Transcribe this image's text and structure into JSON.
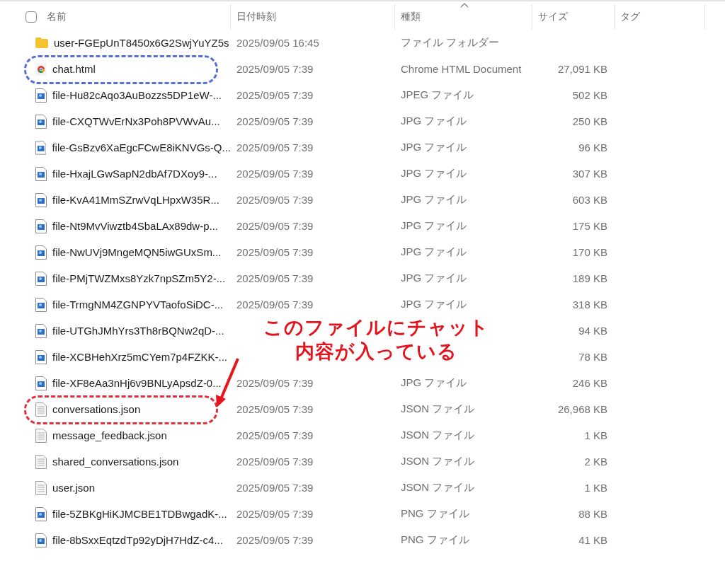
{
  "header": {
    "select_all_checked": false,
    "columns": [
      {
        "label": "名前",
        "sorted": false
      },
      {
        "label": "日付時刻",
        "sorted": false
      },
      {
        "label": "種類",
        "sorted": true
      },
      {
        "label": "サイズ",
        "sorted": false
      },
      {
        "label": "タグ",
        "sorted": false
      }
    ]
  },
  "rows": [
    {
      "kind": "folder",
      "name": "user-FGEpUnT8450x6G2SwjYuYZ5s",
      "date": "2025/09/05 16:45",
      "type": "ファイル フォルダー",
      "circled": false
    },
    {
      "kind": "html",
      "name": "chat.html",
      "date": "2025/09/05 7:39",
      "type": "Chrome HTML Document",
      "size": "27,091 KB",
      "circled": true,
      "color": "#5470d8"
    },
    {
      "kind": "image",
      "name": "file-Hu82cAqo3AuBozzs5DP1eW-...",
      "date": "2025/09/05 7:39",
      "type": "JPEG ファイル",
      "size": "502 KB",
      "circled": false
    },
    {
      "kind": "image",
      "name": "file-CXQTWvErNx3Poh8PVWvAu...",
      "date": "2025/09/05 7:39",
      "type": "JPG ファイル",
      "size": "250 KB",
      "circled": false
    },
    {
      "kind": "image",
      "name": "file-GsBzv6XaEgcFCwE8iKNVGs-Q...",
      "date": "2025/09/05 7:39",
      "type": "JPG ファイル",
      "size": "96 KB",
      "circled": false
    },
    {
      "kind": "image",
      "name": "file-HxajLGwSapN2dbAf7DXoy9-...",
      "date": "2025/09/05 7:39",
      "type": "JPG ファイル",
      "size": "307 KB",
      "circled": false
    },
    {
      "kind": "image",
      "name": "file-KvA41MmSZrwVqLHpxW35R...",
      "date": "2025/09/05 7:39",
      "type": "JPG ファイル",
      "size": "603 KB",
      "circled": false
    },
    {
      "kind": "image",
      "name": "file-Nt9MvViwztb4SbaLAx89dw-p...",
      "date": "2025/09/05 7:39",
      "type": "JPG ファイル",
      "size": "175 KB",
      "circled": false
    },
    {
      "kind": "image",
      "name": "file-NwUVj9MngeMQN5iwGUxSm...",
      "date": "2025/09/05 7:39",
      "type": "JPG ファイル",
      "size": "170 KB",
      "circled": false
    },
    {
      "kind": "image",
      "name": "file-PMjTWZMxs8Yzk7npSZm5Y2-...",
      "date": "2025/09/05 7:39",
      "type": "JPG ファイル",
      "size": "189 KB",
      "circled": false
    },
    {
      "kind": "image",
      "name": "file-TrmgNM4ZGNPYVTaofoSiDC-...",
      "date": "2025/09/05 7:39",
      "type": "JPG ファイル",
      "size": "318 KB",
      "circled": false
    },
    {
      "kind": "image",
      "name": "file-UTGhJMhYrs3Th8rBQNw2qD-...",
      "size": "94 KB",
      "circled": false
    },
    {
      "kind": "image",
      "name": "file-XCBHehXrz5mCYem7p4FZKK-...",
      "size": "78 KB",
      "circled": false
    },
    {
      "kind": "image",
      "name": "file-XF8eAa3nHj6v9BNLyApsdZ-0...",
      "date": "2025/09/05 7:39",
      "type": "JPG ファイル",
      "size": "246 KB",
      "circled": false
    },
    {
      "kind": "text",
      "name": "conversations.json",
      "date": "2025/09/05 7:39",
      "type": "JSON ファイル",
      "size": "26,968 KB",
      "circled": true,
      "color": "#e0303c"
    },
    {
      "kind": "text",
      "name": "message_feedback.json",
      "date": "2025/09/05 7:39",
      "type": "JSON ファイル",
      "size": "1 KB",
      "circled": false
    },
    {
      "kind": "text",
      "name": "shared_conversations.json",
      "date": "2025/09/05 7:39",
      "type": "JSON ファイル",
      "size": "2 KB",
      "circled": false
    },
    {
      "kind": "text",
      "name": "user.json",
      "date": "2025/09/05 7:39",
      "type": "JSON ファイル",
      "size": "1 KB",
      "circled": false
    },
    {
      "kind": "image",
      "name": "file-5ZBKgHiKJMCBE1TDBwgadK-...",
      "date": "2025/09/05 7:39",
      "type": "PNG ファイル",
      "size": "88 KB",
      "circled": false
    },
    {
      "kind": "image",
      "name": "file-8bSxxEqtzdTp92yDjH7HdZ-c4...",
      "date": "2025/09/05 7:39",
      "type": "PNG ファイル",
      "size": "41 KB",
      "circled": false
    }
  ],
  "callout": {
    "lines": [
      "このファイルにチャット",
      "内容が入っている"
    ]
  }
}
